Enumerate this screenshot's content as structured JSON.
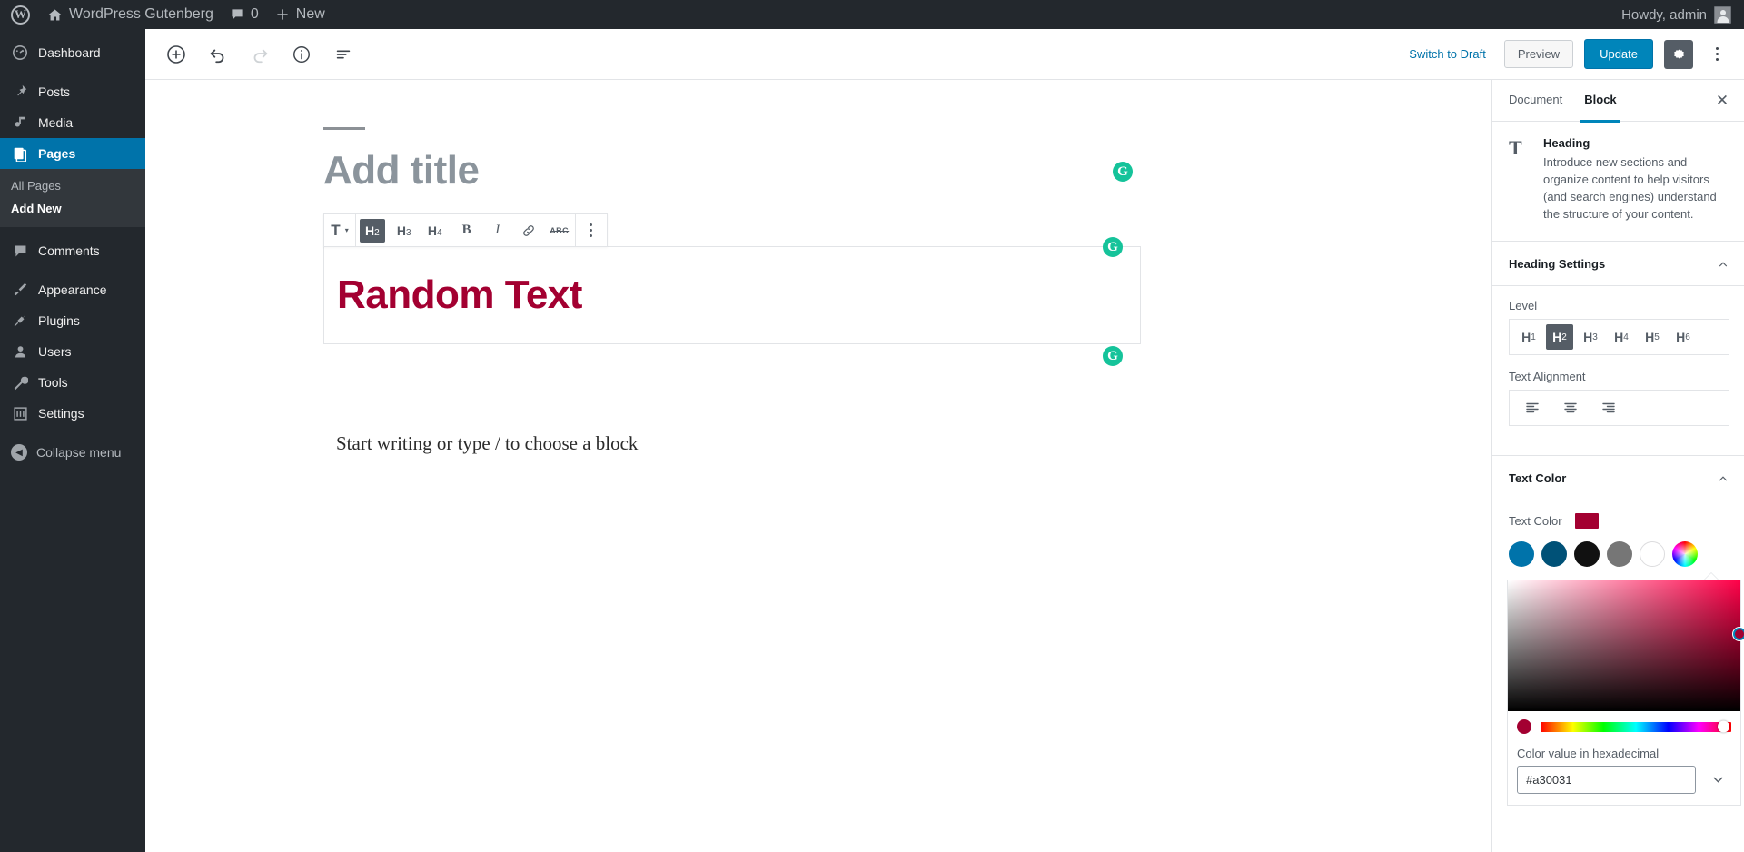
{
  "adminbar": {
    "logo_icon": "wordpress-logo-icon",
    "site_name": "WordPress Gutenberg",
    "home_icon": "home-icon",
    "comments_icon": "comment-bubble-icon",
    "comments_count": "0",
    "new_icon": "plus-icon",
    "new_label": "New",
    "howdy": "Howdy, admin",
    "avatar_icon": "user-avatar-icon"
  },
  "adminmenu": {
    "items": [
      {
        "label": "Dashboard",
        "icon": "dashboard-icon",
        "current": false
      },
      {
        "label": "Posts",
        "icon": "pin-icon",
        "current": false
      },
      {
        "label": "Media",
        "icon": "media-icon",
        "current": false
      },
      {
        "label": "Pages",
        "icon": "pages-icon",
        "current": true
      },
      {
        "label": "Comments",
        "icon": "comment-bubble-icon",
        "current": false
      },
      {
        "label": "Appearance",
        "icon": "paintbrush-icon",
        "current": false
      },
      {
        "label": "Plugins",
        "icon": "plug-icon",
        "current": false
      },
      {
        "label": "Users",
        "icon": "user-icon",
        "current": false
      },
      {
        "label": "Tools",
        "icon": "wrench-icon",
        "current": false
      },
      {
        "label": "Settings",
        "icon": "sliders-icon",
        "current": false
      }
    ],
    "submenu": [
      {
        "label": "All Pages",
        "active": false
      },
      {
        "label": "Add New",
        "active": true
      }
    ],
    "collapse_label": "Collapse menu",
    "collapse_icon": "arrow-left-circle-icon"
  },
  "editor_header": {
    "add_block_icon": "plus-circle-icon",
    "undo_icon": "undo-arrow-icon",
    "redo_icon": "redo-arrow-icon",
    "info_icon": "info-circle-icon",
    "outline_icon": "list-view-icon",
    "switch_to_draft": "Switch to Draft",
    "preview": "Preview",
    "update": "Update",
    "settings_gear_icon": "gear-icon",
    "more_menu_icon": "kebab-menu-icon"
  },
  "canvas": {
    "title_placeholder": "Add title",
    "heading_text": "Random Text",
    "heading_color": "#a30031",
    "paragraph_placeholder": "Start writing or type / to choose a block",
    "grammarly_icon": "grammarly-g-icon",
    "block_toolbar": {
      "type_icon": "text-type-T-icon",
      "type_chevron": "chevron-down-icon",
      "levels": [
        {
          "label": "H",
          "sub": "2",
          "active": true
        },
        {
          "label": "H",
          "sub": "3",
          "active": false
        },
        {
          "label": "H",
          "sub": "4",
          "active": false
        }
      ],
      "bold_icon": "bold-B-icon",
      "italic_icon": "italic-I-icon",
      "link_icon": "link-chain-icon",
      "strikethrough_icon": "strikethrough-abc-icon",
      "more_icon": "kebab-menu-icon"
    }
  },
  "settings": {
    "tabs": [
      {
        "label": "Document",
        "active": false
      },
      {
        "label": "Block",
        "active": true
      }
    ],
    "close_icon": "close-x-icon",
    "block_card": {
      "icon": "heading-T-icon",
      "title": "Heading",
      "description": "Introduce new sections and organize content to help visitors (and search engines) understand the structure of your content."
    },
    "heading_panel": {
      "title": "Heading Settings",
      "chevron_icon": "chevron-up-icon",
      "level_label": "Level",
      "levels": [
        {
          "label": "H",
          "sub": "1",
          "active": false
        },
        {
          "label": "H",
          "sub": "2",
          "active": true
        },
        {
          "label": "H",
          "sub": "3",
          "active": false
        },
        {
          "label": "H",
          "sub": "4",
          "active": false
        },
        {
          "label": "H",
          "sub": "5",
          "active": false
        },
        {
          "label": "H",
          "sub": "6",
          "active": false
        }
      ],
      "alignment_label": "Text Alignment",
      "alignments": [
        {
          "icon": "align-left-icon"
        },
        {
          "icon": "align-center-icon"
        },
        {
          "icon": "align-right-icon"
        }
      ]
    },
    "text_color_panel": {
      "title": "Text Color",
      "chevron_icon": "chevron-up-icon",
      "field_label": "Text Color",
      "current_color": "#a30031",
      "swatches": [
        {
          "name": "pale-blue",
          "color": "#0073aa"
        },
        {
          "name": "dark-blue",
          "color": "#005177"
        },
        {
          "name": "black",
          "color": "#111111"
        },
        {
          "name": "gray",
          "color": "#767676"
        },
        {
          "name": "white",
          "color": "#ffffff"
        },
        {
          "name": "custom-color-wheel",
          "color": "custom"
        }
      ],
      "picker": {
        "saturation_icon": "saturation-value-area",
        "hue_icon": "hue-slider",
        "hex_label": "Color value in hexadecimal",
        "hex_value": "#a30031",
        "expand_icon": "chevron-down-icon"
      }
    }
  }
}
